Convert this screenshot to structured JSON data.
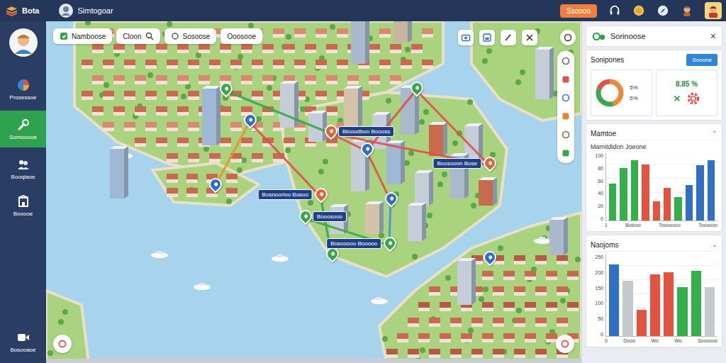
{
  "topbar": {
    "brand": "Bota",
    "user": "Simtogoar",
    "action_button": "Ssoooo"
  },
  "sidebar": {
    "items": [
      {
        "label": "Prosessoe",
        "selected": false
      },
      {
        "label": "Somooooe",
        "selected": true
      },
      {
        "label": "Booqiaoe",
        "selected": false
      },
      {
        "label": "Booooe",
        "selected": false
      },
      {
        "label": "Bosooaoe",
        "selected": false
      }
    ]
  },
  "map": {
    "filters": [
      {
        "label": "Namboose"
      },
      {
        "label": "Cloon"
      },
      {
        "label": "Sosoose"
      },
      {
        "label": "Ooosooe"
      }
    ],
    "pins": [
      {
        "color": "#3aa84a"
      },
      {
        "color": "#2f6fc8"
      },
      {
        "color": "#e0643a",
        "label": "Blooodbon Boooss"
      },
      {
        "color": "#3aa84a"
      },
      {
        "color": "#2f6fc8"
      },
      {
        "color": "#e0643a",
        "label": "Boosooon Bose"
      },
      {
        "color": "#e0643a",
        "label": "Bosnoorloo Bosoo"
      },
      {
        "color": "#2f6fc8"
      },
      {
        "color": "#3aa84a",
        "label": "Booosooo"
      },
      {
        "color": "#3aa84a",
        "label": "Bosooooo Booooo"
      },
      {
        "color": "#2f6fc8"
      },
      {
        "color": "#2f6fc8"
      },
      {
        "color": "#3aa84a"
      }
    ],
    "routes": [
      {
        "color": "#3aa84a"
      },
      {
        "color": "#e2504a"
      },
      {
        "color": "#e2504a"
      },
      {
        "color": "#e2504a"
      },
      {
        "color": "#e2504a"
      },
      {
        "color": "#4a8ee0"
      },
      {
        "color": "#3aa84a"
      },
      {
        "color": "#f0902e"
      },
      {
        "color": "#e2504a"
      },
      {
        "color": "#e2504a"
      },
      {
        "color": "#3aa84a"
      }
    ]
  },
  "panel": {
    "header": {
      "title": "Sorinoose",
      "close": "×"
    },
    "summary": {
      "title": "Sonipones",
      "button": "Sooone",
      "donut": {
        "segments": [
          {
            "value": 45,
            "color": "#f0873a"
          },
          {
            "value": 35,
            "color": "#3aa84a"
          },
          {
            "value": 20,
            "color": "#e2504a"
          }
        ],
        "labels": [
          "5%",
          "5%"
        ]
      },
      "stats": {
        "value": "8.85 %"
      }
    },
    "sections": [
      {
        "title": "Mamtoe",
        "caret": "⌃",
        "chart": {
          "title": "Mamitdidon Joeone",
          "y_ticks": [
            "100",
            "80",
            "60",
            "40",
            "20",
            "0"
          ],
          "x_labels": [
            "1",
            "Bolooo",
            "Tooooooo",
            "Toooooo"
          ],
          "bars": [
            {
              "value": 55,
              "color": "#34b04a"
            },
            {
              "value": 78,
              "color": "#34b04a"
            },
            {
              "value": 90,
              "color": "#34b04a"
            },
            {
              "value": 83,
              "color": "#e4533f"
            },
            {
              "value": 28,
              "color": "#e4533f"
            },
            {
              "value": 48,
              "color": "#e4533f"
            },
            {
              "value": 35,
              "color": "#34b04a"
            },
            {
              "value": 53,
              "color": "#2f6fc8"
            },
            {
              "value": 82,
              "color": "#2f6fc8"
            },
            {
              "value": 90,
              "color": "#2f6fc8"
            }
          ]
        }
      },
      {
        "title": "Naojoms",
        "caret": "⌄",
        "chart": {
          "y_ticks": [
            "250",
            "200",
            "150",
            "100",
            "50",
            "0"
          ],
          "x_labels": [
            "0",
            "Dooo",
            "Wo",
            "Wo",
            "Soooooo"
          ],
          "bars": [
            {
              "value": 220,
              "color": "#2f6fc8"
            },
            {
              "value": 170,
              "color": "#c5c9ce"
            },
            {
              "value": 80,
              "color": "#e4533f"
            },
            {
              "value": 190,
              "color": "#e4533f"
            },
            {
              "value": 195,
              "color": "#e4533f"
            },
            {
              "value": 150,
              "color": "#34b04a"
            },
            {
              "value": 200,
              "color": "#34b04a"
            },
            {
              "value": 150,
              "color": "#c5c9ce"
            }
          ]
        }
      }
    ]
  }
}
